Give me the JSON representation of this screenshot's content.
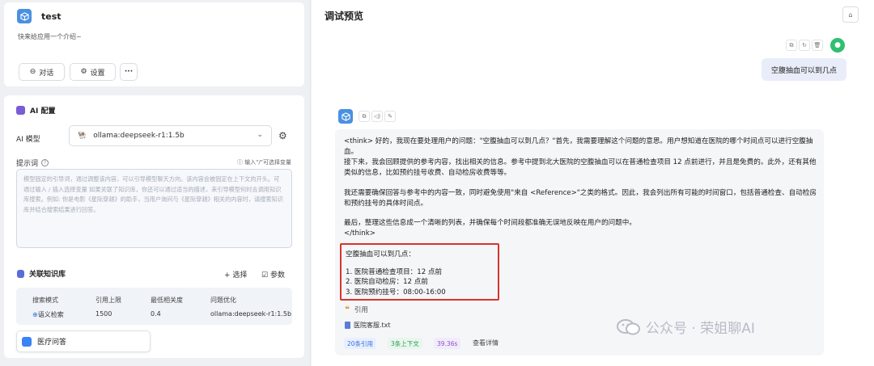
{
  "app": {
    "name": "test",
    "description": "快来给应用一个介绍~",
    "chat_button": "对话",
    "settings_button": "设置",
    "more_button": "···"
  },
  "ai_config": {
    "title": "AI 配置",
    "model_label": "AI 模型",
    "model_value": "ollama:deepseek-r1:1.5b",
    "prompt_label": "提示词",
    "prompt_hint": "输入\"/\"可选择变量",
    "prompt_placeholder": "模型固定的引导词，通过调整该内容，可以引导模型聊天方向。该内容会被固定在上下文的开头。可通过输入 / 插入选择变量 如果关联了知识库，你还可以通过适当的描述，来引导模型何时去调用知识库搜索。例如: 你是电影《星际穿越》的助手，当用户询问与《星际穿越》相关的内容时，请搜索知识库并结合搜索结果进行回答。"
  },
  "knowledge_base": {
    "title": "关联知识库",
    "select_button": "+ 选择",
    "params_button": "参数",
    "columns": [
      "搜索模式",
      "引用上限",
      "最低相关度",
      "问题优化"
    ],
    "row": [
      "语义检索",
      "1500",
      "0.4",
      "ollama:deepseek-r1:1.5b"
    ],
    "dataset": "医疗问答"
  },
  "preview": {
    "title": "调试预览",
    "user_question": "空腹抽血可以到几点",
    "think_p1": "<think> 好的，我现在要处理用户的问题：\"空腹抽血可以到几点？\"首先，我需要理解这个问题的意思。用户想知道在医院的哪个时间点可以进行空腹抽血。",
    "think_p2": "接下来，我会回顾提供的参考内容，找出相关的信息。参考中提到北大医院的空腹抽血可以在普通检查项目 12 点前进行，并且是免费的。此外，还有其他类似的信息，比如预约挂号收费、自动检房收费等等。",
    "think_p3": "我还需要确保回答与参考中的内容一致，同时避免使用\"来自 <Reference>\"之类的格式。因此，我会列出所有可能的时间窗口，包括普通检查、自动检房和预约挂号的具体时间点。",
    "think_p4": "最后，整理这些信息成一个清晰的列表，并确保每个时间段都准确无误地反映在用户的问题中。",
    "think_end": "</think>",
    "answer_title": "空腹抽血可以到几点：",
    "answer_items": [
      "1. 医院普通检查项目：12 点前",
      "2. 医院自动检房：12 点前",
      "3. 医院预约挂号：08:00-16:00"
    ],
    "quote_label": "引用",
    "quote_file": "医院客服.txt",
    "badge_refs": "20条引用",
    "badge_context": "3条上下文",
    "badge_time": "39.36s",
    "details_link": "查看详情"
  },
  "watermark": "公众号 · 荣姐聊AI",
  "colors": {
    "accent": "#4a90e2",
    "highlight_border": "#d8342c",
    "user_bubble": "#e9edf9",
    "avatar_green": "#2fbf71"
  }
}
